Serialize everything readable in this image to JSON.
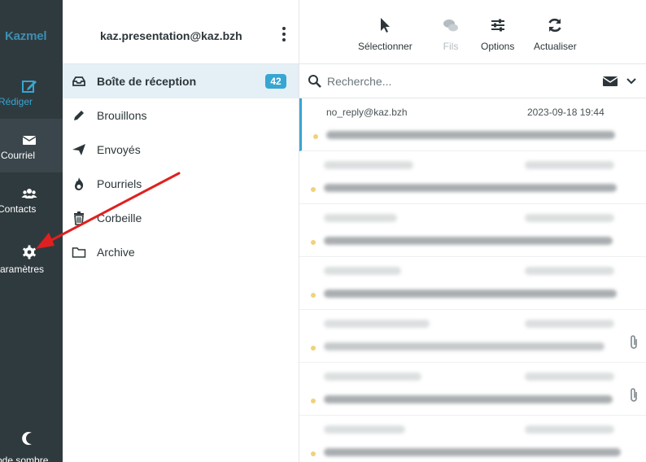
{
  "app": {
    "brand": "Kazmel"
  },
  "nav": {
    "items": [
      {
        "label": "Rédiger",
        "icon": "compose-icon"
      },
      {
        "label": "Courriel",
        "icon": "envelope-icon"
      },
      {
        "label": "Contacts",
        "icon": "contacts-icon"
      },
      {
        "label": "Paramètres",
        "icon": "gear-icon"
      },
      {
        "label": "Mode sombre",
        "icon": "moon-icon"
      }
    ]
  },
  "account": {
    "email": "kaz.presentation@kaz.bzh"
  },
  "folders": [
    {
      "label": "Boîte de réception",
      "icon": "inbox-icon",
      "badge": "42"
    },
    {
      "label": "Brouillons",
      "icon": "pencil-icon"
    },
    {
      "label": "Envoyés",
      "icon": "paper-plane-icon"
    },
    {
      "label": "Pourriels",
      "icon": "fire-icon"
    },
    {
      "label": "Corbeille",
      "icon": "trash-icon"
    },
    {
      "label": "Archive",
      "icon": "folder-icon"
    }
  ],
  "toolbar": {
    "select_label": "Sélectionner",
    "threads_label": "Fils",
    "options_label": "Options",
    "refresh_label": "Actualiser"
  },
  "search": {
    "placeholder": "Recherche..."
  },
  "messages": [
    {
      "from": "no_reply@kaz.bzh",
      "date": "2023-09-18 19:44"
    }
  ],
  "colors": {
    "sidebar": "#2f3a3f",
    "accent": "#37a6d2",
    "annotation_arrow": "#e02020"
  }
}
